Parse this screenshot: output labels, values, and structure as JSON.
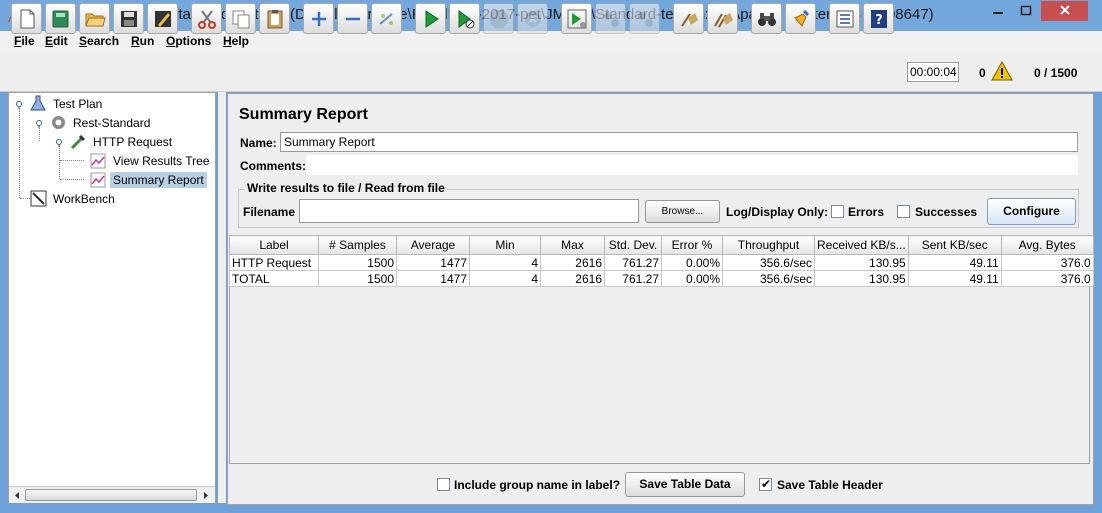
{
  "window": {
    "title": "Standard-test.jmx (D:\\AKlymArchive\\RoadMap-2017-pet\\JMeter\\Standard-test.jmx) - Apache JMeter (3.3 r1808647)"
  },
  "menu": {
    "items": [
      {
        "label": "File",
        "mnemonic": "F",
        "rest": "ile"
      },
      {
        "label": "Edit",
        "mnemonic": "E",
        "rest": "dit"
      },
      {
        "label": "Search",
        "mnemonic": "S",
        "rest": "earch"
      },
      {
        "label": "Run",
        "mnemonic": "R",
        "rest": "un"
      },
      {
        "label": "Options",
        "mnemonic": "O",
        "rest": "ptions"
      },
      {
        "label": "Help",
        "mnemonic": "H",
        "rest": "elp"
      }
    ]
  },
  "status": {
    "elapsed_time": "00:00:04",
    "error_count": "0",
    "threads": "0 / 1500"
  },
  "tree": {
    "items": [
      {
        "label": "Test Plan"
      },
      {
        "label": "Rest-Standard"
      },
      {
        "label": "HTTP Request"
      },
      {
        "label": "View Results Tree"
      },
      {
        "label": "Summary Report"
      },
      {
        "label": "WorkBench"
      }
    ]
  },
  "report": {
    "title": "Summary Report",
    "name_label": "Name:",
    "name_value": "Summary Report",
    "comments_label": "Comments:",
    "file_section_title": "Write results to file / Read from file",
    "filename_label": "Filename",
    "browse_label": "Browse...",
    "log_display_label": "Log/Display Only:",
    "errors_label": "Errors",
    "successes_label": "Successes",
    "configure_label": "Configure"
  },
  "table": {
    "columns": [
      "Label",
      "# Samples",
      "Average",
      "Min",
      "Max",
      "Std. Dev.",
      "Error %",
      "Throughput",
      "Received KB/s...",
      "Sent KB/sec",
      "Avg. Bytes"
    ],
    "rows": [
      [
        "HTTP Request",
        "1500",
        "1477",
        "4",
        "2616",
        "761.27",
        "0.00%",
        "356.6/sec",
        "130.95",
        "49.11",
        "376.0"
      ],
      [
        "TOTAL",
        "1500",
        "1477",
        "4",
        "2616",
        "761.27",
        "0.00%",
        "356.6/sec",
        "130.95",
        "49.11",
        "376.0"
      ]
    ]
  },
  "bottom": {
    "include_group_label": "Include group name in label?",
    "save_table_data_label": "Save Table Data",
    "save_table_header_label": "Save Table Header",
    "save_table_header_checked": true
  }
}
